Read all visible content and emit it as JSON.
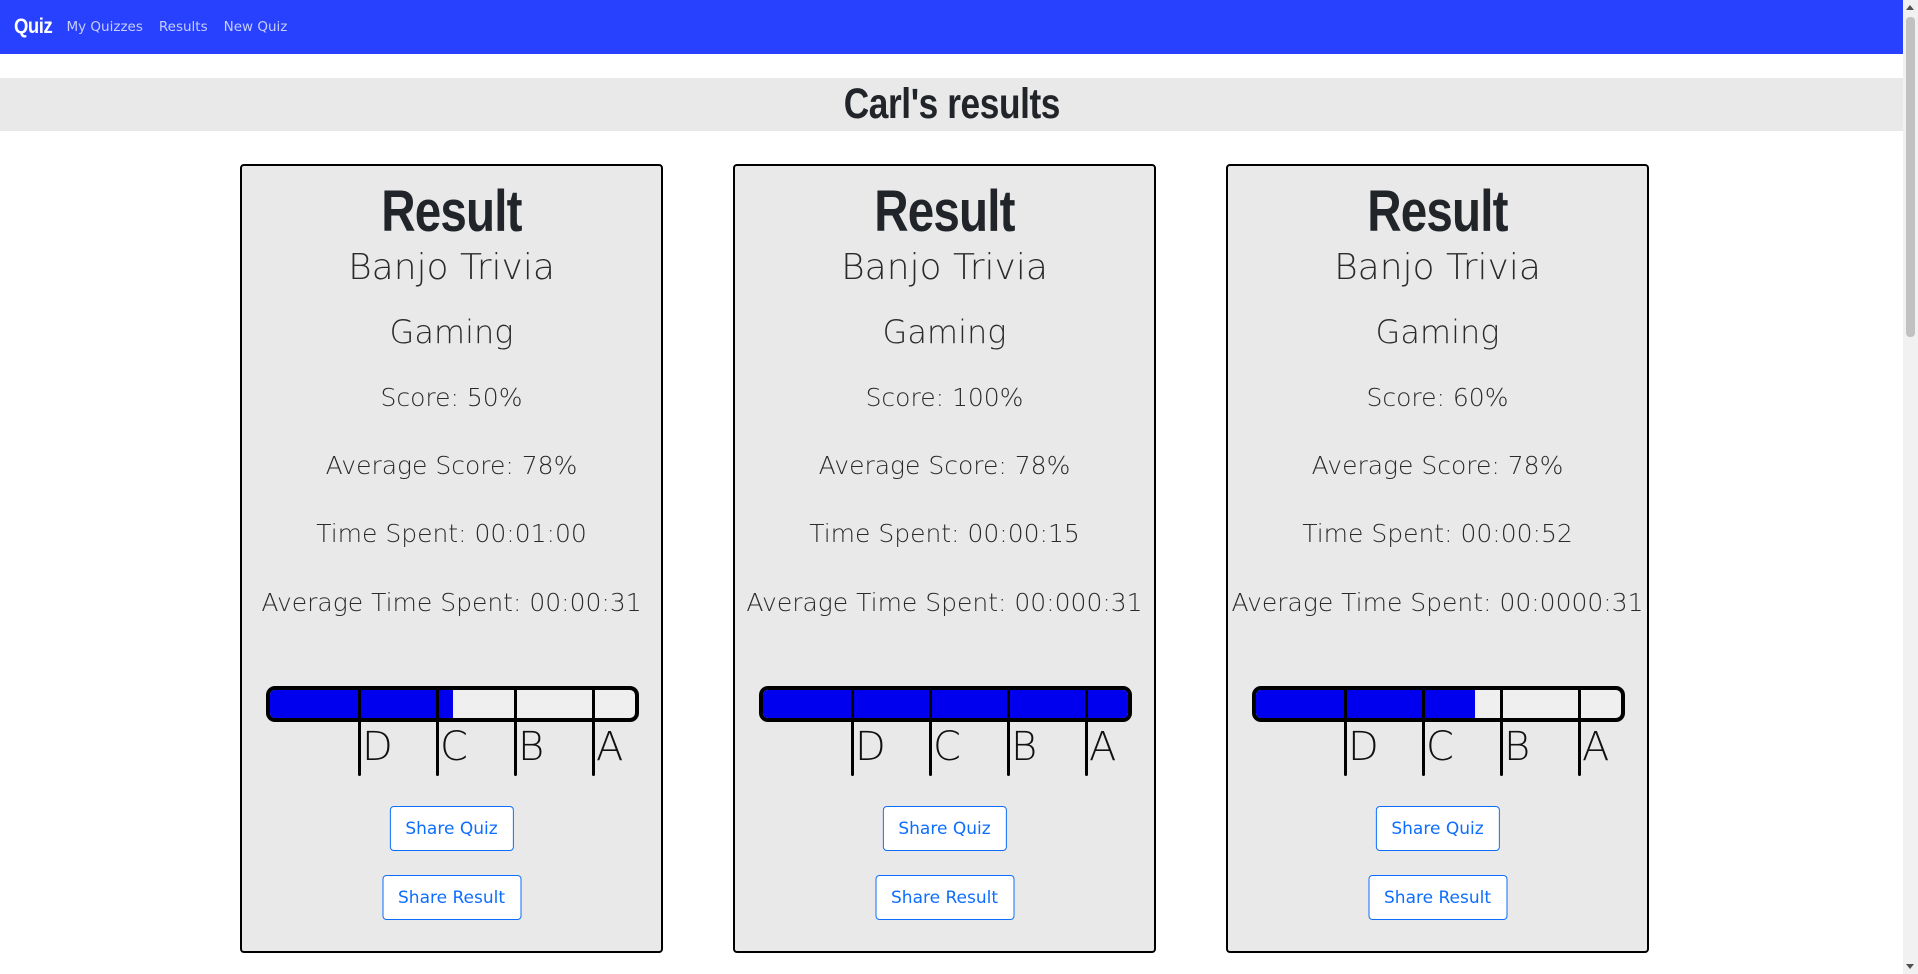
{
  "navbar": {
    "brand": "Quiz",
    "links": [
      "My Quizzes",
      "Results",
      "New Quiz"
    ],
    "background": "#2741ff"
  },
  "page": {
    "title": "Carl's results"
  },
  "cards": [
    {
      "heading": "Result",
      "quiz_name": "Banjo Trivia",
      "category": "Gaming",
      "score": "Score: 50%",
      "average_score": "Average Score: 78%",
      "time_spent": "Time Spent: 00:01:00",
      "average_time": "Average Time Spent: 00:00:31",
      "score_fraction": 0.5,
      "grade_labels": [
        "D",
        "C",
        "B",
        "A"
      ],
      "share_quiz": "Share Quiz",
      "share_result": "Share Result"
    },
    {
      "heading": "Result",
      "quiz_name": "Banjo Trivia",
      "category": "Gaming",
      "score": "Score: 100%",
      "average_score": "Average Score: 78%",
      "time_spent": "Time Spent: 00:00:15",
      "average_time": "Average Time Spent: 00:000:31",
      "score_fraction": 1.0,
      "grade_labels": [
        "D",
        "C",
        "B",
        "A"
      ],
      "share_quiz": "Share Quiz",
      "share_result": "Share Result"
    },
    {
      "heading": "Result",
      "quiz_name": "Banjo Trivia",
      "category": "Gaming",
      "score": "Score: 60%",
      "average_score": "Average Score: 78%",
      "time_spent": "Time Spent: 00:00:52",
      "average_time": "Average Time Spent: 00:0000:31",
      "score_fraction": 0.6,
      "grade_labels": [
        "D",
        "C",
        "B",
        "A"
      ],
      "share_quiz": "Share Quiz",
      "share_result": "Share Result"
    }
  ],
  "colors": {
    "progress_fill": "#0000ee",
    "button_accent": "#0d6efd",
    "card_background": "#e9e9e9"
  }
}
